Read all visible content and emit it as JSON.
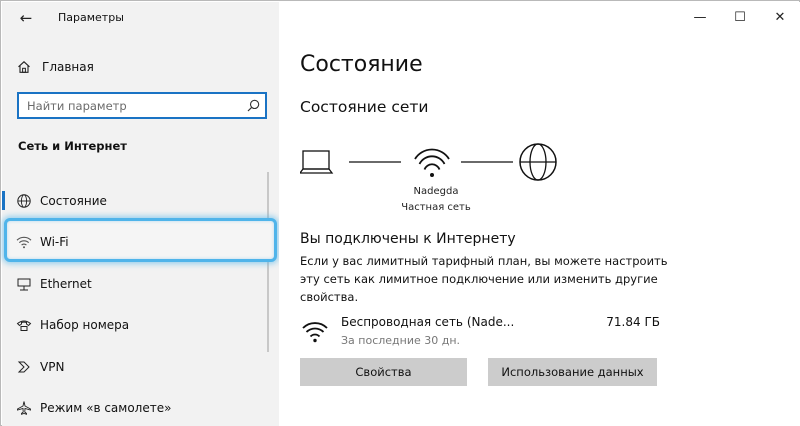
{
  "window": {
    "title": "Параметры",
    "controls": {
      "minimize": "—",
      "maximize": "☐",
      "close": "✕"
    }
  },
  "sidebar": {
    "back_glyph": "←",
    "home_label": "Главная",
    "search_placeholder": "Найти параметр",
    "section_heading": "Сеть и Интернет",
    "items": [
      {
        "label": "Состояние",
        "icon": "globe-status-icon",
        "selected": true
      },
      {
        "label": "Wi-Fi",
        "icon": "wifi-icon",
        "highlighted": true
      },
      {
        "label": "Ethernet",
        "icon": "ethernet-icon"
      },
      {
        "label": "Набор номера",
        "icon": "dialup-icon"
      },
      {
        "label": "VPN",
        "icon": "vpn-icon"
      },
      {
        "label": "Режим «в самолете»",
        "icon": "airplane-icon"
      }
    ]
  },
  "main": {
    "title": "Состояние",
    "subtitle": "Состояние сети",
    "network": {
      "name": "Nadegda",
      "type": "Частная сеть"
    },
    "connected_title": "Вы подключены к Интернету",
    "connected_desc": "Если у вас лимитный тарифный план, вы можете настроить эту сеть как лимитное подключение или изменить другие свойства.",
    "connection": {
      "name": "Беспроводная сеть (Nade...",
      "sub": "За последние 30 дн.",
      "usage": "71.84 ГБ"
    },
    "buttons": {
      "properties": "Свойства",
      "data_usage": "Использование данных"
    }
  },
  "colors": {
    "accent": "#1a73c4",
    "highlight": "#4fb4ea",
    "sidebar_bg": "#f2f2f2",
    "button_bg": "#cccccc"
  }
}
